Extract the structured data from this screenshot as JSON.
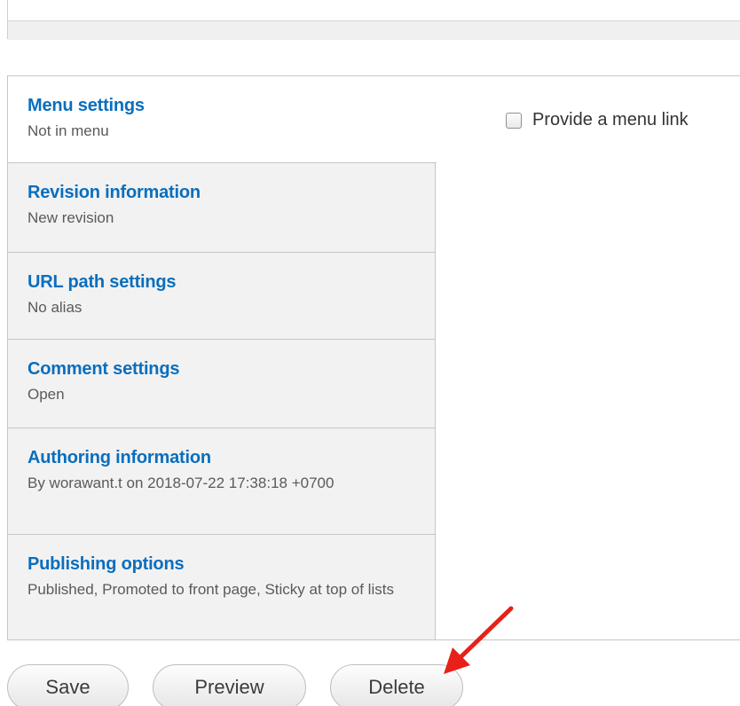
{
  "tabs": [
    {
      "title": "Menu settings",
      "summary": "Not in menu",
      "selected": true
    },
    {
      "title": "Revision information",
      "summary": "New revision",
      "selected": false
    },
    {
      "title": "URL path settings",
      "summary": "No alias",
      "selected": false
    },
    {
      "title": "Comment settings",
      "summary": "Open",
      "selected": false
    },
    {
      "title": "Authoring information",
      "summary": "By worawant.t on 2018-07-22 17:38:18 +0700",
      "selected": false
    },
    {
      "title": "Publishing options",
      "summary": "Published, Promoted to front page, Sticky at top of lists",
      "selected": false
    }
  ],
  "menu_pane": {
    "checkbox_label": "Provide a menu link",
    "checked": false
  },
  "actions": {
    "save": "Save",
    "preview": "Preview",
    "delete": "Delete"
  },
  "colors": {
    "tab_title": "#0a6ebd",
    "annotation_arrow": "#e8201a"
  },
  "icons": {
    "annotation": "red-arrow-icon"
  }
}
